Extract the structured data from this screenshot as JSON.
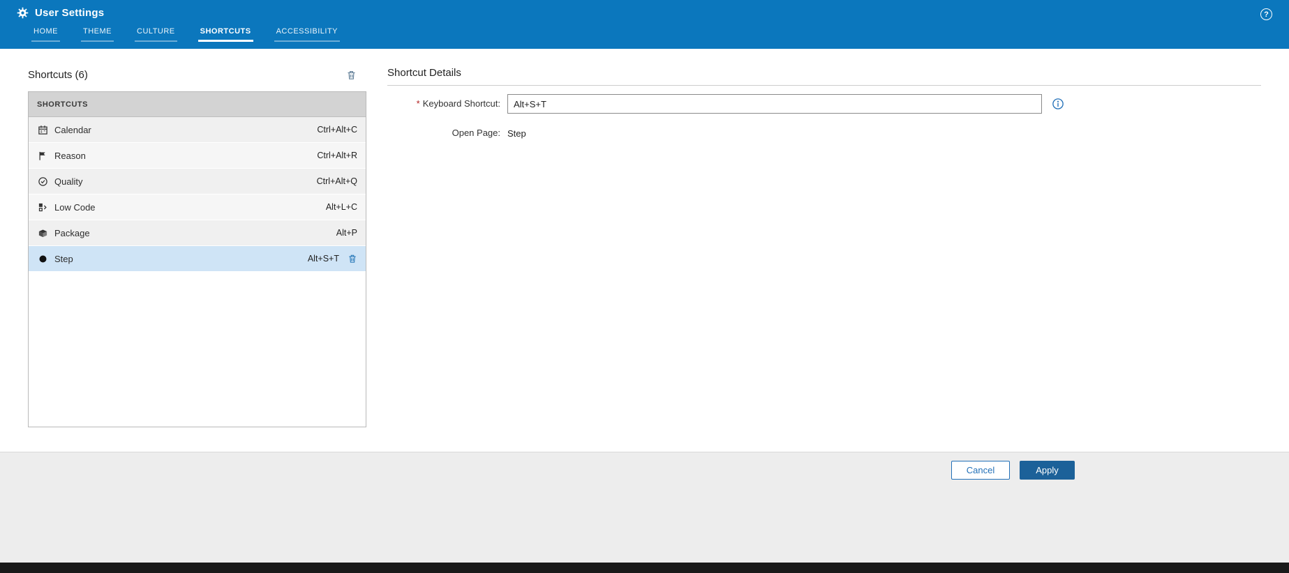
{
  "header": {
    "title": "User Settings",
    "help_glyph": "?",
    "active_tab": "SHORTCUTS",
    "tabs": [
      {
        "label": "HOME"
      },
      {
        "label": "THEME"
      },
      {
        "label": "CULTURE"
      },
      {
        "label": "SHORTCUTS"
      },
      {
        "label": "ACCESSIBILITY"
      }
    ]
  },
  "shortcuts_panel": {
    "title": "Shortcuts (6)",
    "list_header": "SHORTCUTS",
    "rows": [
      {
        "icon": "calendar-icon",
        "label": "Calendar",
        "keys": "Ctrl+Alt+C",
        "selected": false
      },
      {
        "icon": "flag-icon",
        "label": "Reason",
        "keys": "Ctrl+Alt+R",
        "selected": false
      },
      {
        "icon": "quality-seal-icon",
        "label": "Quality",
        "keys": "Ctrl+Alt+Q",
        "selected": false
      },
      {
        "icon": "low-code-icon",
        "label": "Low Code",
        "keys": "Alt+L+C",
        "selected": false
      },
      {
        "icon": "package-icon",
        "label": "Package",
        "keys": "Alt+P",
        "selected": false
      },
      {
        "icon": "step-icon",
        "label": "Step",
        "keys": "Alt+S+T",
        "selected": true
      }
    ]
  },
  "details_panel": {
    "title": "Shortcut Details",
    "required_marker": "*",
    "keyboard_shortcut": {
      "label": "Keyboard Shortcut:",
      "value": "Alt+S+T"
    },
    "open_page": {
      "label": "Open Page:",
      "value": "Step"
    }
  },
  "footer": {
    "cancel_label": "Cancel",
    "apply_label": "Apply"
  },
  "colors": {
    "header_blue": "#0b77bd",
    "selected_row_blue": "#cfe4f6",
    "apply_button_blue": "#1c6199",
    "link_blue": "#2270b8",
    "required_red": "#b22222"
  }
}
